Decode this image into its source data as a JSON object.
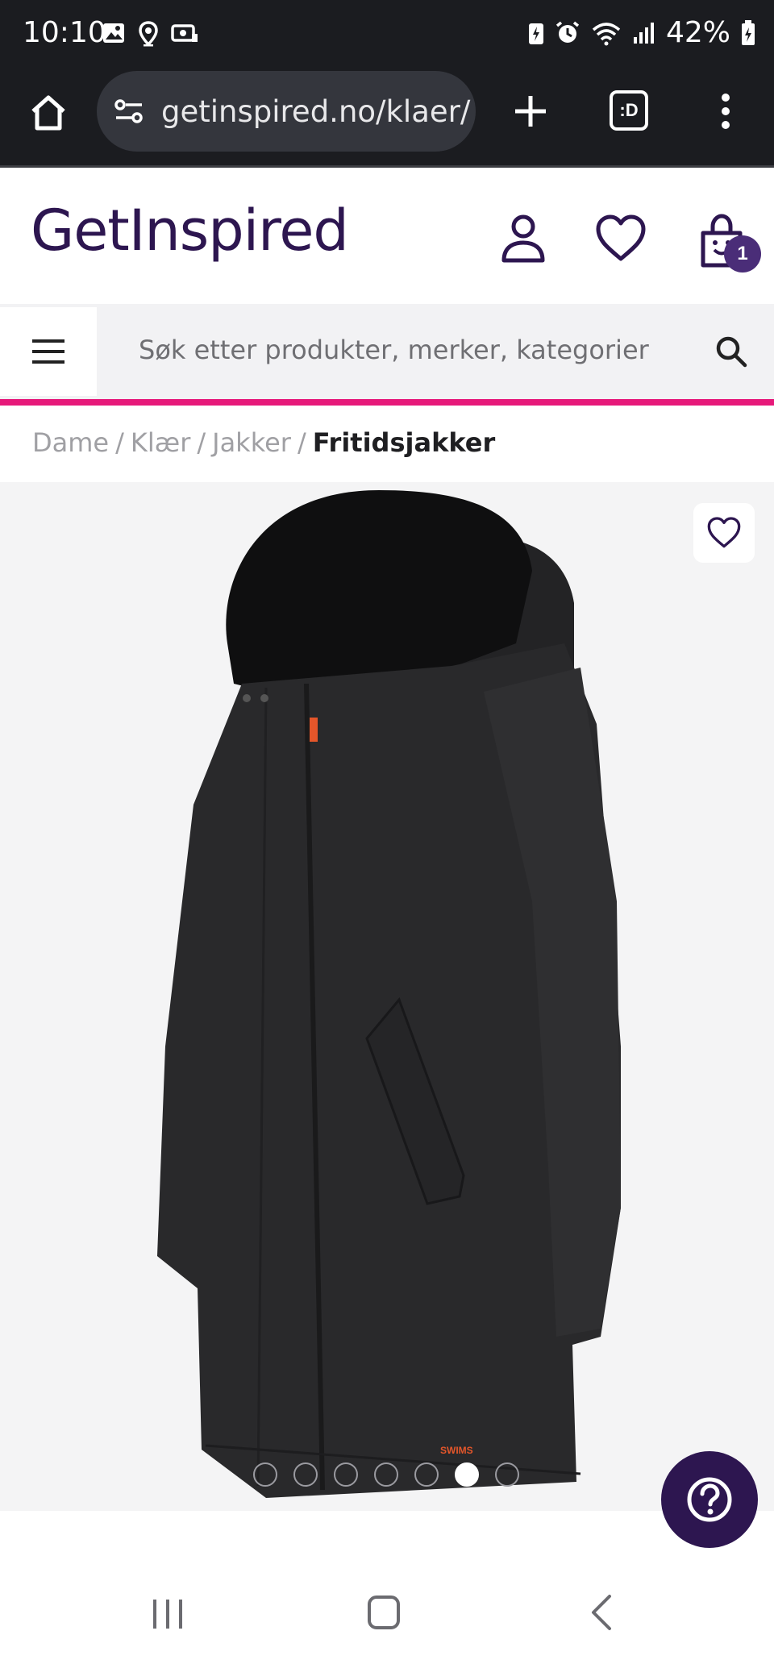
{
  "status_bar": {
    "time": "10:10",
    "battery": "42%",
    "left_icons": [
      "image-icon",
      "location-icon",
      "camera-icon"
    ],
    "right_icons": [
      "battery-saver-icon",
      "alarm-icon",
      "wifi-icon",
      "signal-icon",
      "battery-icon"
    ]
  },
  "browser": {
    "url": "getinspired.no/klaer/",
    "tabs_label": ":D"
  },
  "header": {
    "logo": "GetInspired",
    "cart_count": "1"
  },
  "search": {
    "placeholder": "Søk etter produkter, merker, kategorier"
  },
  "breadcrumb": {
    "items": [
      "Dame",
      "Klær",
      "Jakker"
    ],
    "current": "Fritidsjakker"
  },
  "product_image": {
    "brand_mark": "SWIMS",
    "slide_count": 7,
    "active_slide": 6
  },
  "colors": {
    "brand_dark": "#2d1650",
    "accent_pink": "#e6197a",
    "badge": "#4a2d78"
  }
}
